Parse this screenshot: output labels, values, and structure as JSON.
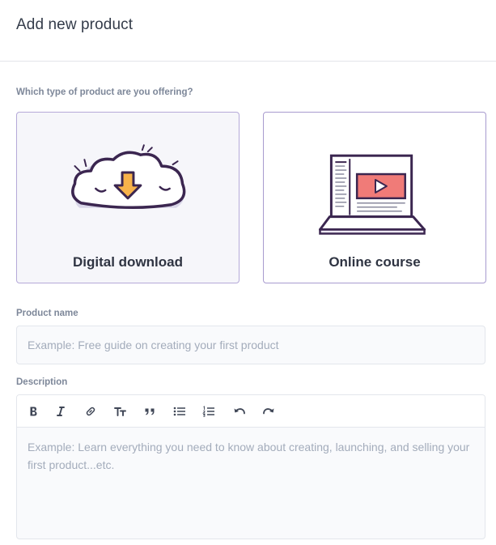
{
  "header": {
    "title": "Add new product"
  },
  "product_type": {
    "question": "Which type of product are you offering?",
    "options": [
      {
        "label": "Digital download",
        "icon": "cloud-download-icon",
        "selected": true
      },
      {
        "label": "Online course",
        "icon": "laptop-video-icon",
        "selected": false
      }
    ]
  },
  "product_name": {
    "label": "Product name",
    "placeholder": "Example: Free guide on creating your first product",
    "value": ""
  },
  "description": {
    "label": "Description",
    "placeholder": "Example: Learn everything you need to know about creating, launching, and selling your first product...etc.",
    "value": "",
    "toolbar": [
      "bold-icon",
      "italic-icon",
      "link-icon",
      "text-size-icon",
      "quote-icon",
      "bulleted-list-icon",
      "numbered-list-icon",
      "undo-icon",
      "redo-icon"
    ]
  },
  "colors": {
    "accent_border": "#a89bcf",
    "selected_bg": "#f6f6fa",
    "arrow": "#f7b24a",
    "screen": "#f07b78",
    "outline": "#3b2650"
  }
}
